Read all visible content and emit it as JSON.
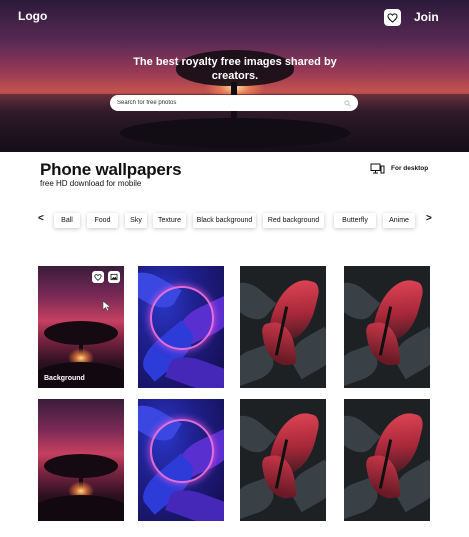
{
  "header": {
    "logo": "Logo",
    "join_label": "Join",
    "favorites_icon": "heart-icon",
    "tagline": "The best royalty free images shared by creators.",
    "search": {
      "placeholder": "Search for free photos",
      "icon": "search-icon"
    }
  },
  "section": {
    "title": "Phone wallpapers",
    "subtitle": "free HD download for mobile",
    "desktop_link": "For desktop",
    "desktop_icon": "monitor-icon"
  },
  "categories": {
    "prev_label": "<",
    "next_label": ">",
    "items": [
      "Ball",
      "Food",
      "Sky",
      "Texture",
      "Black background",
      "Red background",
      "Butterfly",
      "Anime"
    ]
  },
  "gallery": {
    "items": [
      {
        "type": "sunset",
        "label": "Background"
      },
      {
        "type": "neon"
      },
      {
        "type": "butterfly"
      },
      {
        "type": "butterfly"
      },
      {
        "type": "sunset"
      },
      {
        "type": "neon"
      },
      {
        "type": "butterfly"
      },
      {
        "type": "butterfly"
      }
    ],
    "first_tile_actions": [
      "heart-icon",
      "image-icon"
    ]
  },
  "colors": {
    "hero_sky_top": "#2b1a3a",
    "hero_sky_glow": "#c4524e",
    "neon_blue": "#2a35c8",
    "neon_pink": "#ff78dc",
    "butterfly_red": "#e84a5a",
    "butterfly_bg": "#1d2124"
  }
}
